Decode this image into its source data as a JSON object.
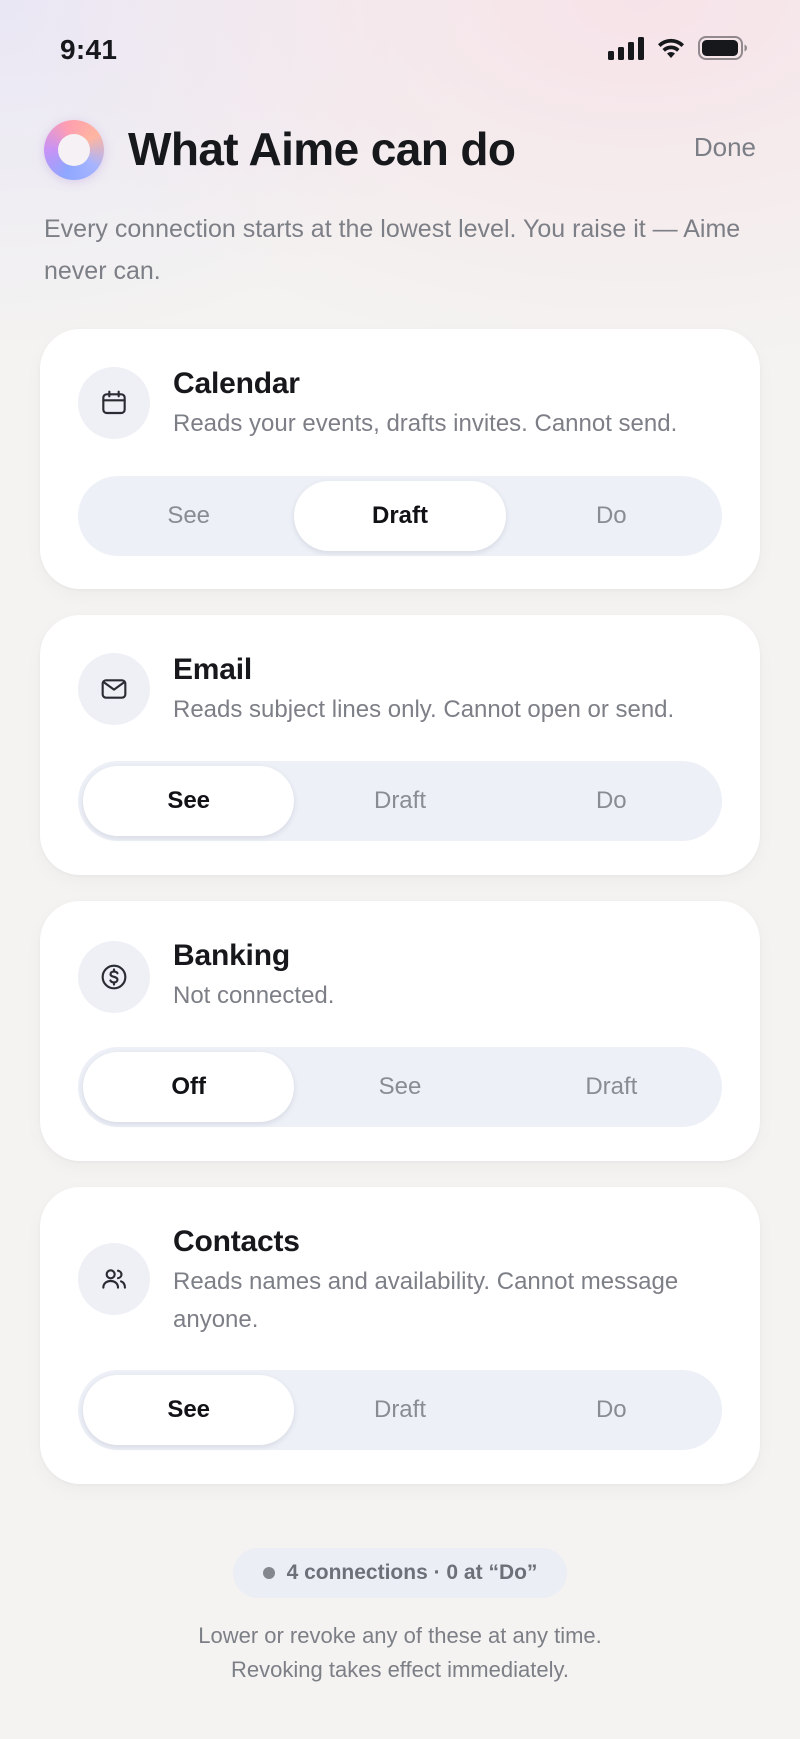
{
  "status_bar": {
    "time": "9:41"
  },
  "header": {
    "title": "What Aime can do",
    "done_label": "Done",
    "subtitle": "Every connection starts at the lowest level. You raise it — Aime never can."
  },
  "connections": [
    {
      "name": "Calendar",
      "icon": "calendar-icon",
      "description": "Reads your events, drafts invites. Cannot send.",
      "levels": [
        "See",
        "Draft",
        "Do"
      ],
      "selected": "Draft"
    },
    {
      "name": "Email",
      "icon": "mail-icon",
      "description": "Reads subject lines only. Cannot open or send.",
      "levels": [
        "See",
        "Draft",
        "Do"
      ],
      "selected": "See"
    },
    {
      "name": "Banking",
      "icon": "dollar-icon",
      "description": "Not connected.",
      "levels": [
        "Off",
        "See",
        "Draft"
      ],
      "selected": "Off"
    },
    {
      "name": "Contacts",
      "icon": "people-icon",
      "description": "Reads names and availability. Cannot message anyone.",
      "levels": [
        "See",
        "Draft",
        "Do"
      ],
      "selected": "See"
    }
  ],
  "footer": {
    "summary": "4 connections · 0 at “Do”",
    "note_line1": "Lower or revoke any of these at any time.",
    "note_line2": "Revoking takes effect immediately."
  }
}
